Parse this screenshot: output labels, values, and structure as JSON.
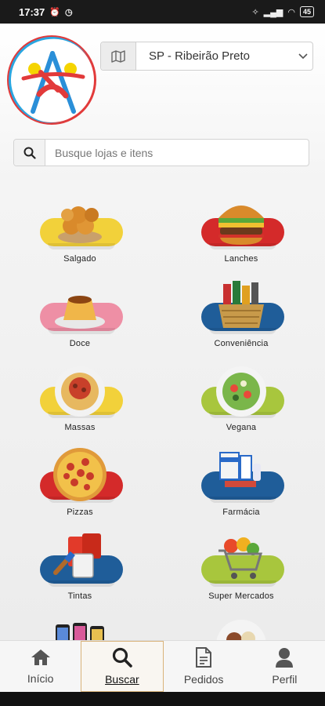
{
  "status_bar": {
    "time": "17:37",
    "battery": "45"
  },
  "header": {
    "location": "SP - Ribeirão Preto"
  },
  "search": {
    "placeholder": "Busque lojas e itens"
  },
  "categories": [
    {
      "label": "Salgado",
      "pill_color": "#f2d13a",
      "icon": "fried-snacks-icon"
    },
    {
      "label": "Lanches",
      "pill_color": "#d42a2a",
      "icon": "burger-icon"
    },
    {
      "label": "Doce",
      "pill_color": "#ee8fa5",
      "icon": "pudding-icon"
    },
    {
      "label": "Conveniência",
      "pill_color": "#1f5d99",
      "icon": "basket-icon"
    },
    {
      "label": "Massas",
      "pill_color": "#f2d13a",
      "icon": "pasta-icon"
    },
    {
      "label": "Vegana",
      "pill_color": "#a8c63d",
      "icon": "salad-icon"
    },
    {
      "label": "Pizzas",
      "pill_color": "#d42a2a",
      "icon": "pizza-icon"
    },
    {
      "label": "Farmácia",
      "pill_color": "#1f5d99",
      "icon": "pharmacy-icon"
    },
    {
      "label": "Tintas",
      "pill_color": "#1f5d99",
      "icon": "paint-icon"
    },
    {
      "label": "Super Mercados",
      "pill_color": "#a8c63d",
      "icon": "cart-icon"
    },
    {
      "label": "",
      "pill_color": "#1f5d99",
      "icon": "phones-icon"
    },
    {
      "label": "",
      "pill_color": "#d42a2a",
      "icon": "meal-icon"
    }
  ],
  "nav": [
    {
      "label": "Início",
      "icon": "home-icon",
      "active": false
    },
    {
      "label": "Buscar",
      "icon": "search-icon",
      "active": true
    },
    {
      "label": "Pedidos",
      "icon": "document-icon",
      "active": false
    },
    {
      "label": "Perfil",
      "icon": "user-icon",
      "active": false
    }
  ]
}
